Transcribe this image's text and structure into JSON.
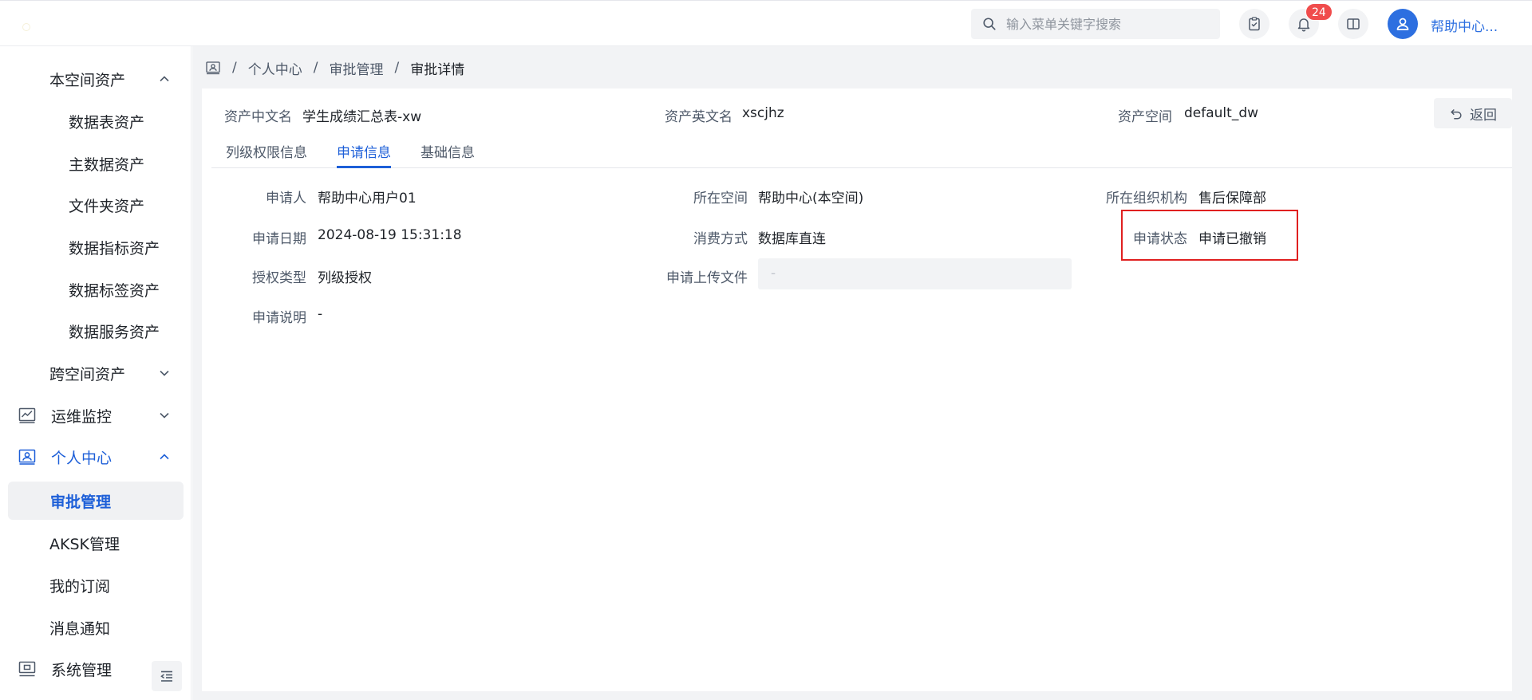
{
  "header": {
    "search_placeholder": "输入菜单关键字搜索",
    "notification_count": "24",
    "user_name": "帮助中心..."
  },
  "sidebar": {
    "items": [
      {
        "label": "本空间资产",
        "expanded": true
      },
      {
        "label": "数据表资产"
      },
      {
        "label": "主数据资产"
      },
      {
        "label": "文件夹资产"
      },
      {
        "label": "数据指标资产"
      },
      {
        "label": "数据标签资产"
      },
      {
        "label": "数据服务资产"
      },
      {
        "label": "跨空间资产",
        "expanded": false
      },
      {
        "label": "运维监控",
        "icon": "chart-icon",
        "expanded": false
      },
      {
        "label": "个人中心",
        "icon": "user-card-icon",
        "expanded": true
      },
      {
        "label": "审批管理",
        "selected": true
      },
      {
        "label": "AKSK管理"
      },
      {
        "label": "我的订阅"
      },
      {
        "label": "消息通知"
      },
      {
        "label": "系统管理",
        "icon": "monitor-icon"
      }
    ]
  },
  "breadcrumb": [
    "个人中心",
    "审批管理",
    "审批详情"
  ],
  "asset_info": {
    "cn_name_label": "资产中文名",
    "cn_name_value": "学生成绩汇总表-xw",
    "en_name_label": "资产英文名",
    "en_name_value": "xscjhz",
    "space_label": "资产空间",
    "space_value": "default_dw"
  },
  "back_button": "返回",
  "tabs": [
    {
      "label": "列级权限信息"
    },
    {
      "label": "申请信息",
      "active": true
    },
    {
      "label": "基础信息"
    }
  ],
  "fields": {
    "applicant_label": "申请人",
    "applicant_value": "帮助中心用户01",
    "space_label": "所在空间",
    "space_value": "帮助中心(本空间)",
    "org_label": "所在组织机构",
    "org_value": "售后保障部",
    "date_label": "申请日期",
    "date_value": "2024-08-19 15:31:18",
    "consume_label": "消费方式",
    "consume_value": "数据库直连",
    "status_label": "申请状态",
    "status_value": "申请已撤销",
    "auth_type_label": "授权类型",
    "auth_type_value": "列级授权",
    "upload_label": "申请上传文件",
    "upload_value": "-",
    "desc_label": "申请说明",
    "desc_value": "-"
  },
  "colors": {
    "accent": "#1d5fd8",
    "highlight": "#e02020",
    "badge": "#f04c4c"
  }
}
